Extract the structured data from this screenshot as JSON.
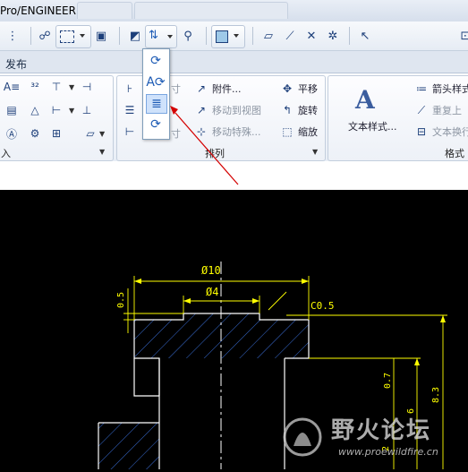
{
  "app_title": "Pro/ENGINEER",
  "ribbon_tab": "发布",
  "annotate_group": {
    "label_left": "入"
  },
  "format_buttons": {
    "row1_dim_label": "寸",
    "row3_dim_label": "寸"
  },
  "arrange_group": {
    "label": "排列",
    "attach": "附件...",
    "move_to_view": "移动到视图",
    "move_special": "移动特殊...",
    "pan": "平移",
    "rotate": "旋转",
    "scale": "缩放"
  },
  "format_group": {
    "text_style": "文本样式...",
    "arrow_style": "箭头样式",
    "repeat_last": "重复上",
    "text_wrap": "文本换行",
    "label": "格式"
  },
  "drawing": {
    "dim_diameter_10": "Ø10",
    "dim_diameter_4": "Ø4",
    "dim_05": "0.5",
    "dim_chamfer": "C0.5",
    "dim_07": "0.7",
    "dim_83": "8.3",
    "dim_6": "6",
    "dim_2": "2"
  },
  "watermark": {
    "text": "野火论坛",
    "url": "www.proewildfire.cn"
  },
  "colors": {
    "dim": "#ffff00",
    "geometry": "#ffffff",
    "hatch": "#3a6fd8",
    "centerline": "#ffffff",
    "arrow": "#d40000"
  }
}
